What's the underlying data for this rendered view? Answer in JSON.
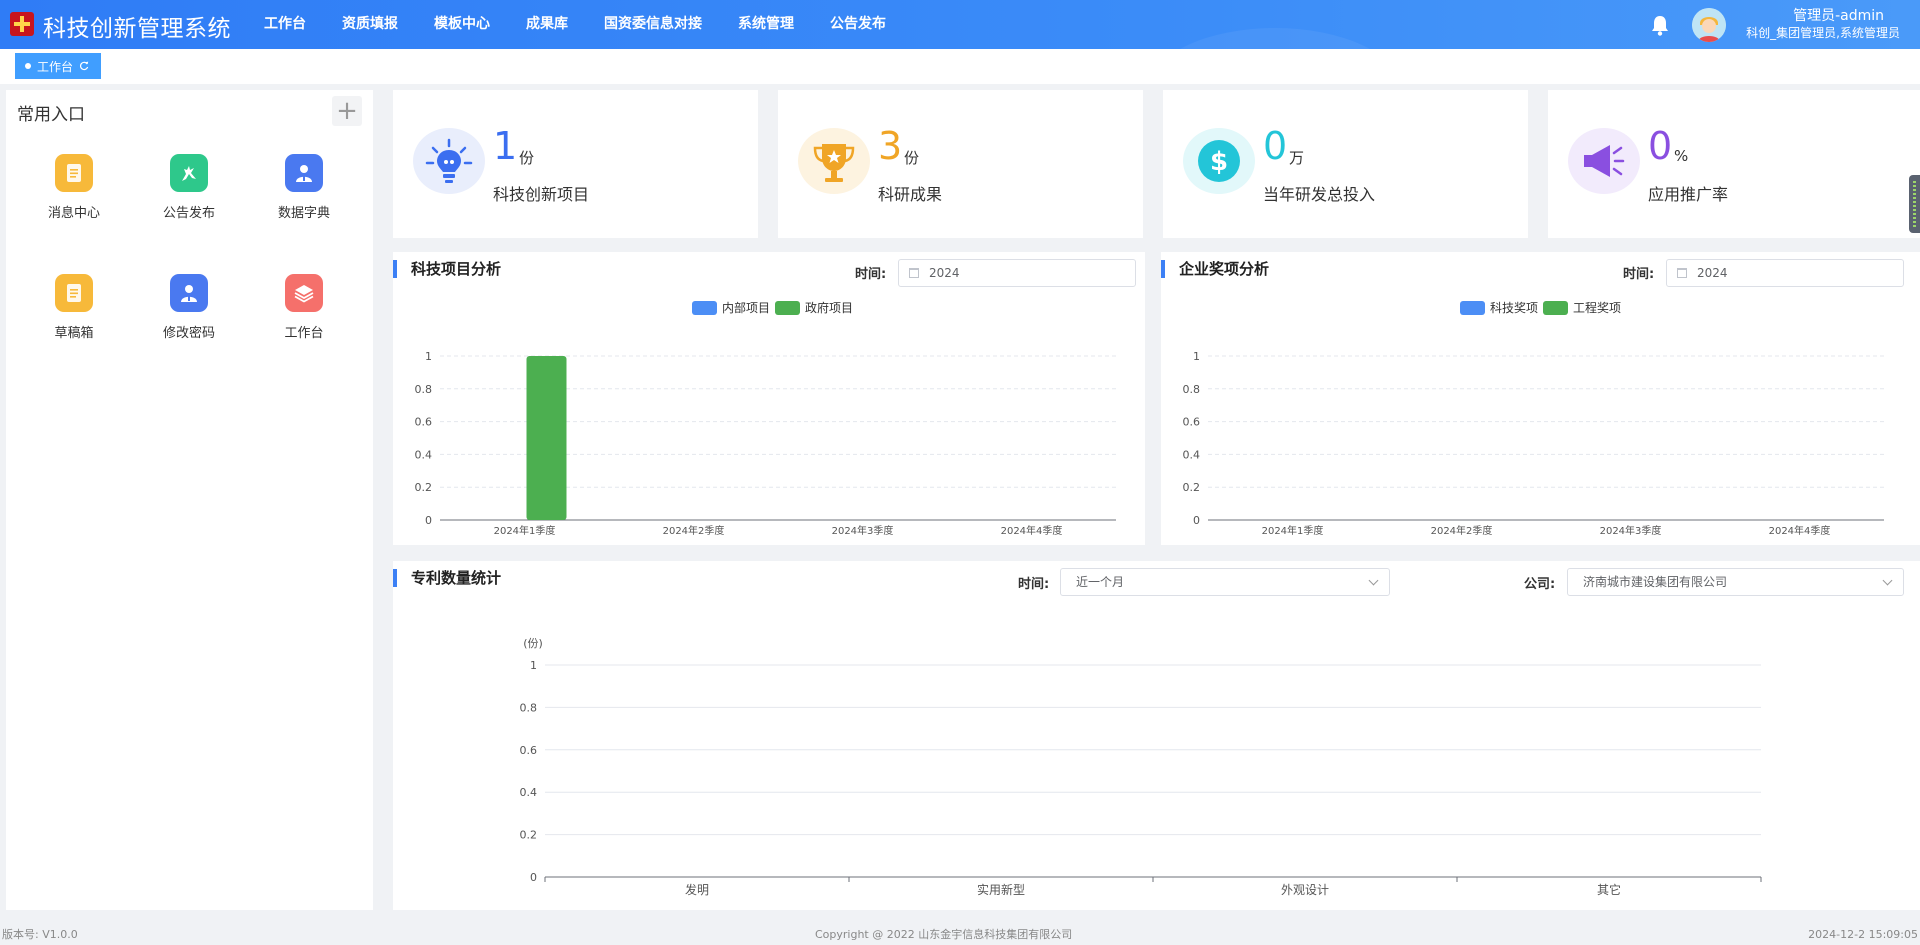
{
  "header": {
    "app_title": "科技创新管理系统",
    "nav": [
      "工作台",
      "资质填报",
      "模板中心",
      "成果库",
      "国资委信息对接",
      "系统管理",
      "公告发布"
    ],
    "user_name": "管理员-admin",
    "user_role": "科创_集团管理员,系统管理员"
  },
  "tabs": [
    {
      "label": "工作台"
    }
  ],
  "shortcuts": {
    "title": "常用入口",
    "items": [
      {
        "label": "消息中心",
        "icon": "document-icon",
        "color": "#f7b93a"
      },
      {
        "label": "公告发布",
        "icon": "deer-icon",
        "color": "#2ec88b"
      },
      {
        "label": "数据字典",
        "icon": "user-card-icon",
        "color": "#4a79f0"
      },
      {
        "label": "草稿箱",
        "icon": "document-icon",
        "color": "#f7b93a"
      },
      {
        "label": "修改密码",
        "icon": "user-card-icon",
        "color": "#4a79f0"
      },
      {
        "label": "工作台",
        "icon": "layers-icon",
        "color": "#f5706b"
      }
    ]
  },
  "stats": [
    {
      "value": "1",
      "unit": "份",
      "label": "科技创新项目",
      "color": "#3b6ef0",
      "icon": "lightbulb-icon"
    },
    {
      "value": "3",
      "unit": "份",
      "label": "科研成果",
      "color": "#f0a526",
      "icon": "trophy-icon"
    },
    {
      "value": "0",
      "unit": "万",
      "label": "当年研发总投入",
      "color": "#23c5d8",
      "icon": "dollar-icon"
    },
    {
      "value": "0",
      "unit": "%",
      "label": "应用推广率",
      "color": "#8a4fe0",
      "icon": "megaphone-icon"
    }
  ],
  "project_chart": {
    "title": "科技项目分析",
    "time_label": "时间:",
    "year": "2024"
  },
  "award_chart": {
    "title": "企业奖项分析",
    "time_label": "时间:",
    "year": "2024"
  },
  "patent_chart": {
    "title": "专利数量统计",
    "time_label": "时间:",
    "time_value": "近一个月",
    "company_label": "公司:",
    "company_value": "济南城市建设集团有限公司"
  },
  "chart_data": [
    {
      "type": "bar",
      "categories": [
        "2024年1季度",
        "2024年2季度",
        "2024年3季度",
        "2024年4季度"
      ],
      "series": [
        {
          "name": "内部项目",
          "values": [
            0,
            0,
            0,
            0
          ],
          "color": "#4c8ef5"
        },
        {
          "name": "政府项目",
          "values": [
            1,
            0,
            0,
            0
          ],
          "color": "#4caf50"
        }
      ],
      "ylim": [
        0,
        1
      ],
      "yticks": [
        "0",
        "0.2",
        "0.4",
        "0.6",
        "0.8",
        "1"
      ],
      "legend": "top-center",
      "grid": true
    },
    {
      "type": "bar",
      "categories": [
        "2024年1季度",
        "2024年2季度",
        "2024年3季度",
        "2024年4季度"
      ],
      "series": [
        {
          "name": "科技奖项",
          "values": [
            0,
            0,
            0,
            0
          ],
          "color": "#4c8ef5"
        },
        {
          "name": "工程奖项",
          "values": [
            0,
            0,
            0,
            0
          ],
          "color": "#4caf50"
        }
      ],
      "ylim": [
        0,
        1
      ],
      "yticks": [
        "0",
        "0.2",
        "0.4",
        "0.6",
        "0.8",
        "1"
      ],
      "legend": "top-center",
      "grid": true
    },
    {
      "type": "bar",
      "categories": [
        "发明",
        "实用新型",
        "外观设计",
        "其它"
      ],
      "series": [
        {
          "values": [
            0,
            0,
            0,
            0
          ],
          "color": "#4c8ef5"
        }
      ],
      "ylabel": "(份)",
      "ylim": [
        0,
        1
      ],
      "yticks": [
        "0",
        "0.2",
        "0.4",
        "0.6",
        "0.8",
        "1"
      ],
      "grid": true
    }
  ],
  "footer": {
    "version": "版本号: V1.0.0",
    "copyright": "Copyright @ 2022 山东金宇信息科技集团有限公司",
    "datetime": "2024-12-2 15:09:05"
  }
}
